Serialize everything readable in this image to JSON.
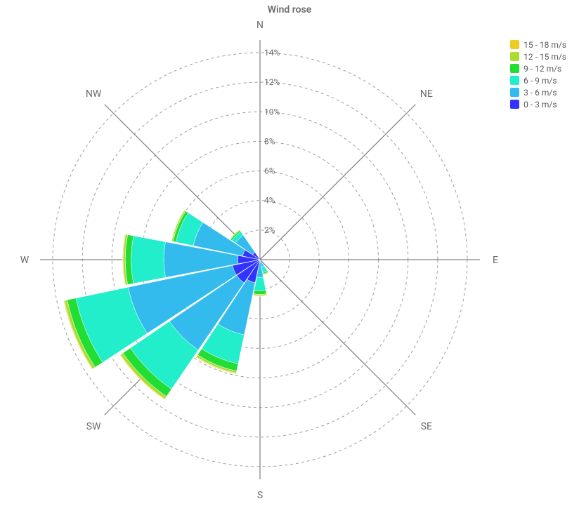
{
  "chart_data": {
    "type": "polar-bar",
    "title": "Wind rose",
    "radial_unit": "%",
    "radial_ticks": [
      2,
      4,
      6,
      8,
      10,
      12,
      14
    ],
    "radial_max": 14,
    "directions_labeled": [
      "N",
      "NE",
      "E",
      "SE",
      "S",
      "SW",
      "W",
      "NW"
    ],
    "sector_count": 16,
    "sector_start_deg": -90,
    "legend_position": "top-right",
    "series": [
      {
        "name": "0 - 3 m/s",
        "color": "#3333ff",
        "values": [
          0,
          0,
          0,
          0,
          0,
          0,
          0,
          0,
          0,
          1.6,
          1.9,
          1.9,
          1.5,
          1.2,
          0.6,
          0
        ]
      },
      {
        "name": "3 - 6 m/s",
        "color": "#33bbee",
        "values": [
          0,
          0,
          0,
          0,
          0,
          0,
          0,
          0.5,
          1.2,
          3.6,
          5.5,
          7.2,
          5.0,
          3.4,
          1.4,
          0
        ]
      },
      {
        "name": "6 - 9 m/s",
        "color": "#22eecc",
        "values": [
          0,
          0,
          0,
          0,
          0,
          0,
          0,
          0.4,
          0.9,
          2.0,
          3.2,
          3.6,
          2.2,
          1.2,
          0.3,
          0
        ]
      },
      {
        "name": "9 - 12 m/s",
        "color": "#22dd33",
        "values": [
          0,
          0,
          0,
          0,
          0,
          0,
          0,
          0.1,
          0.25,
          0.5,
          0.6,
          0.6,
          0.4,
          0.2,
          0.1,
          0
        ]
      },
      {
        "name": "12 - 15 m/s",
        "color": "#aadd33",
        "values": [
          0,
          0,
          0,
          0,
          0,
          0,
          0,
          0.05,
          0.1,
          0.15,
          0.2,
          0.2,
          0.15,
          0.1,
          0.05,
          0
        ]
      },
      {
        "name": "15 - 18 m/s",
        "color": "#eecc22",
        "values": [
          0,
          0,
          0,
          0,
          0,
          0,
          0,
          0,
          0.03,
          0.05,
          0.05,
          0.05,
          0.04,
          0.03,
          0,
          0
        ]
      }
    ],
    "legend_order": [
      "15 - 18 m/s",
      "12 - 15 m/s",
      "9 - 12 m/s",
      "6 - 9 m/s",
      "3 - 6 m/s",
      "0 - 3 m/s"
    ]
  }
}
